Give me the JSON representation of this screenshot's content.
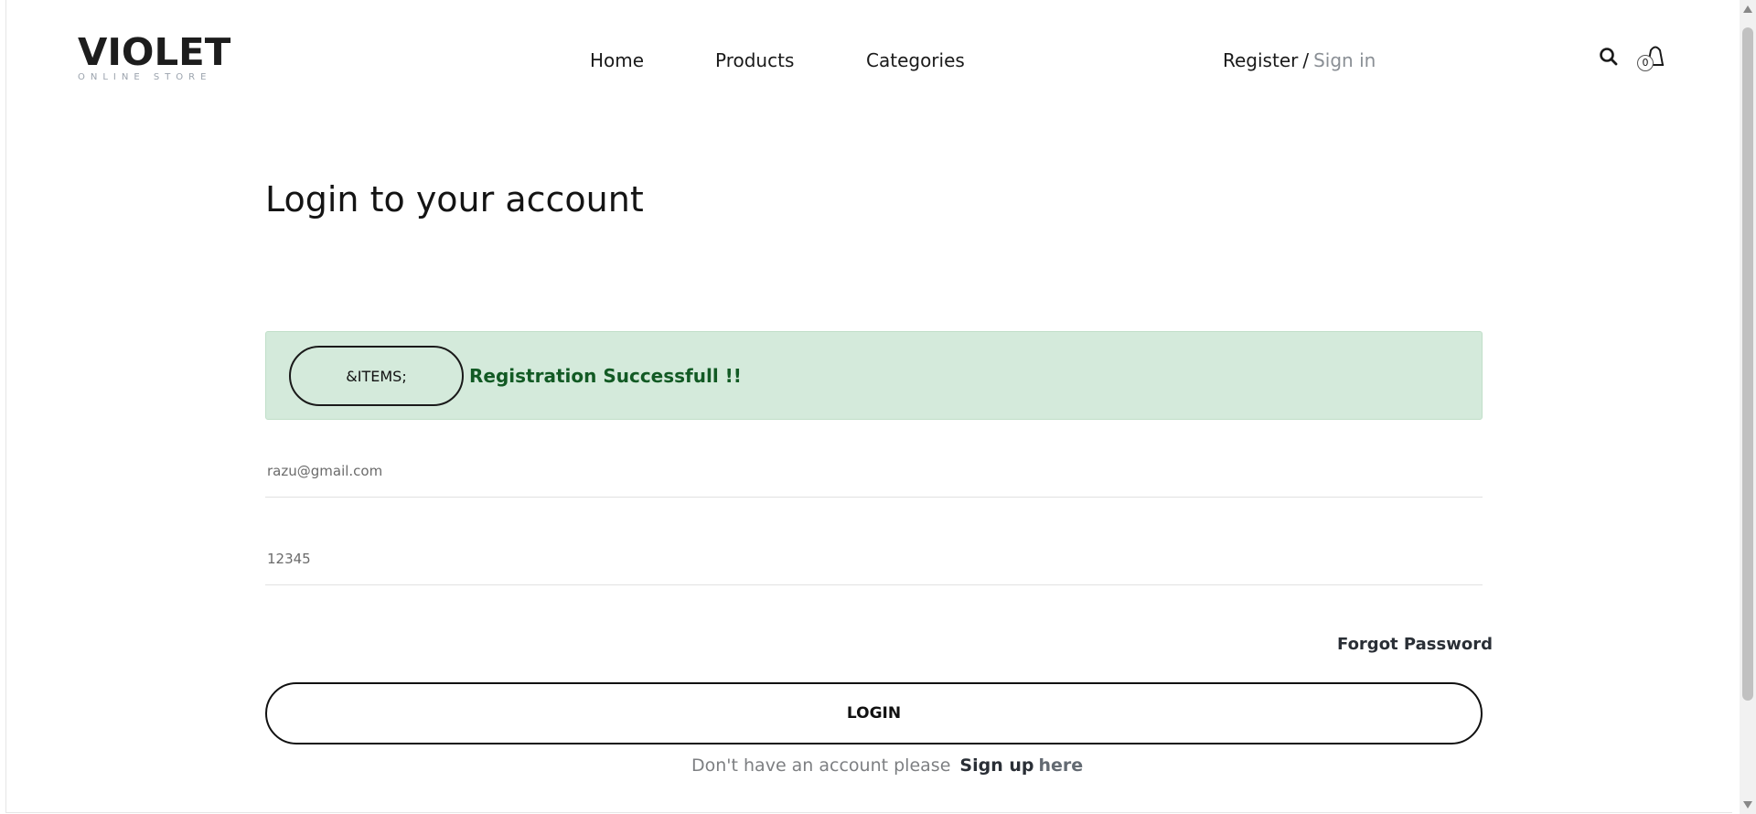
{
  "header": {
    "logo": {
      "main": "VIOLET",
      "sub": "ONLINE STORE"
    },
    "nav": {
      "home": "Home",
      "products": "Products",
      "categories": "Categories"
    },
    "auth": {
      "register": "Register",
      "separator": "/",
      "signin": "Sign in"
    },
    "search_icon": "search-icon",
    "cart": {
      "icon": "shopping-bag-icon",
      "count": "0"
    }
  },
  "main": {
    "title": "Login to your account",
    "alert": {
      "button_label": "&ITEMS;",
      "message": "Registration Successfull !!",
      "background_color": "#d4eadb",
      "text_color": "#125a24"
    },
    "email": {
      "value": "razu@gmail.com"
    },
    "password": {
      "value": "12345"
    },
    "forgot_password": "Forgot Password",
    "login_button": "LOGIN",
    "signup": {
      "prefix": "Don't have an account please",
      "link": "Sign up",
      "here": "here"
    }
  }
}
